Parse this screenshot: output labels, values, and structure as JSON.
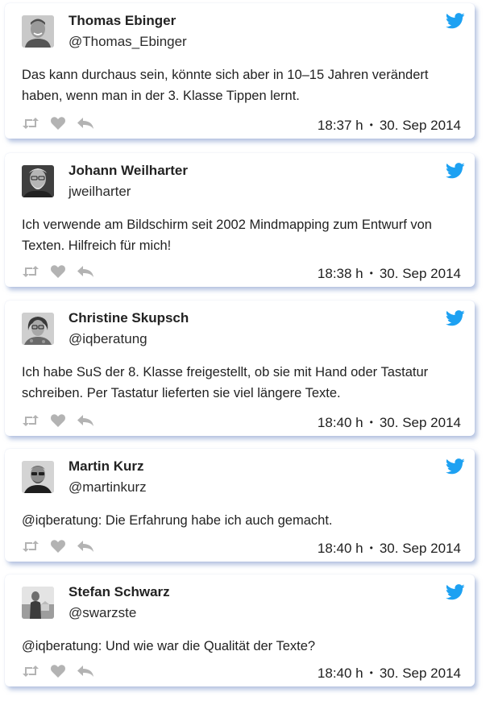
{
  "tweets": [
    {
      "name": "Thomas Ebinger",
      "handle": "@Thomas_Ebinger",
      "text": "Das kann durchaus sein, könnte sich aber in 10–15 Jahren verändert haben, wenn man in der 3. Klasse Tippen lernt.",
      "time": "18:37 h",
      "date": "30. Sep 2014",
      "avatar": "man-photo-icon"
    },
    {
      "name": "Johann Weilharter",
      "handle": "jweilharter",
      "text": "Ich verwende am Bildschirm seit 2002 Mindmapping zum Entwurf von Texten. Hilfreich für mich!",
      "time": "18:38 h",
      "date": "30. Sep 2014",
      "avatar": "bearded-man-photo-icon"
    },
    {
      "name": "Christine Skupsch",
      "handle": "@iqberatung",
      "text": "Ich habe SuS der 8. Klasse freigestellt, ob sie mit Hand oder Tastatur schreiben. Per Tastatur lieferten sie viel längere Texte.",
      "time": "18:40 h",
      "date": "30. Sep 2014",
      "avatar": "woman-photo-icon"
    },
    {
      "name": "Martin Kurz",
      "handle": "@martinkurz",
      "text": "@iqberatung: Die Erfahrung habe ich auch gemacht.",
      "time": "18:40 h",
      "date": "30. Sep 2014",
      "avatar": "man-glasses-photo-icon"
    },
    {
      "name": "Stefan Schwarz",
      "handle": "@swarzste",
      "text": "@iqberatung: Und wie war die Qualität der Texte?",
      "time": "18:40 h",
      "date": "30. Sep 2014",
      "avatar": "man-outdoor-photo-icon"
    }
  ],
  "dot_separator": "•",
  "colors": {
    "twitter_blue": "#1da1f2",
    "action_gray": "#b3b3b3",
    "card_shadow": "#7891c8"
  },
  "icons": [
    "twitter-bird-icon",
    "retweet-icon",
    "like-heart-icon",
    "reply-icon"
  ]
}
